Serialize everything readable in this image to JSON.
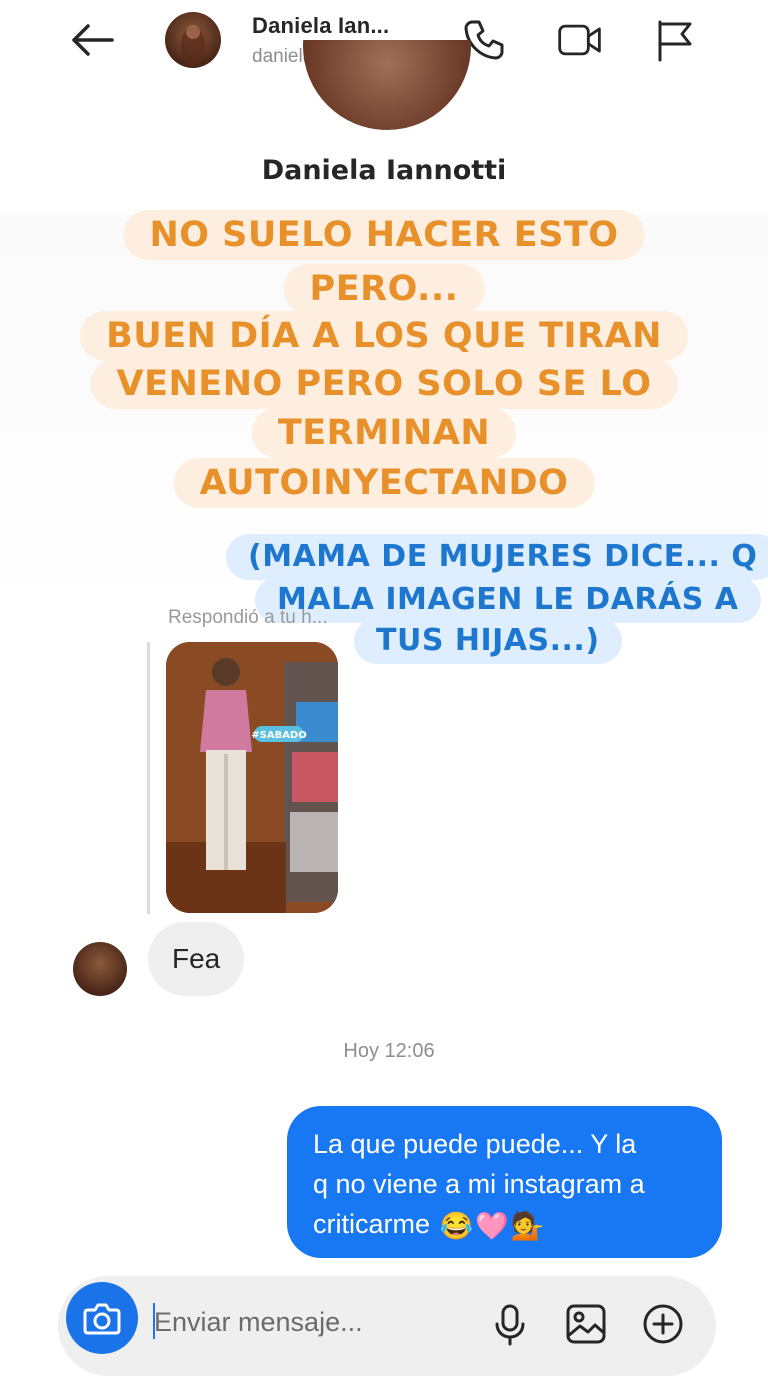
{
  "header": {
    "name": "Daniela Ian...",
    "handle": "danielaiannotti",
    "icons": [
      "back-arrow-icon",
      "phone-icon",
      "video-camera-icon",
      "flag-icon"
    ]
  },
  "story": {
    "author_name": "Daniela Iannotti",
    "caption_lines": [
      "NO SUELO HACER ESTO",
      "PERO...",
      "BUEN DÍA A LOS QUE TIRAN",
      "VENENO PERO SOLO SE LO",
      "TERMINAN",
      "AUTOINYECTANDO"
    ],
    "quote_lines": [
      "(MAMA DE MUJERES DICE... Q",
      "MALA IMAGEN LE DARÁS A",
      "TUS HIJAS...)"
    ],
    "reply_label": "Respondió a tu h...",
    "thumbnail_tag": "#SABADO"
  },
  "messages": {
    "incoming_text": "Fea",
    "timestamp": "Hoy 12:06",
    "outgoing_line1": "La que puede puede... Y la",
    "outgoing_line2": "q no viene a mi instagram a",
    "outgoing_line3": "criticarme",
    "outgoing_emojis": [
      "😂",
      "🩷",
      "💁"
    ]
  },
  "composer": {
    "placeholder": "Enviar mensaje...",
    "icons": [
      "camera-icon",
      "microphone-icon",
      "gallery-icon",
      "plus-icon"
    ]
  },
  "colors": {
    "caption_text": "#e8902a",
    "caption_bg": "#fdeee0",
    "quote_text": "#1e77cf",
    "quote_bg": "#dfeefe",
    "outgoing_bubble": "#1877f2",
    "incoming_bubble": "#efefef"
  }
}
